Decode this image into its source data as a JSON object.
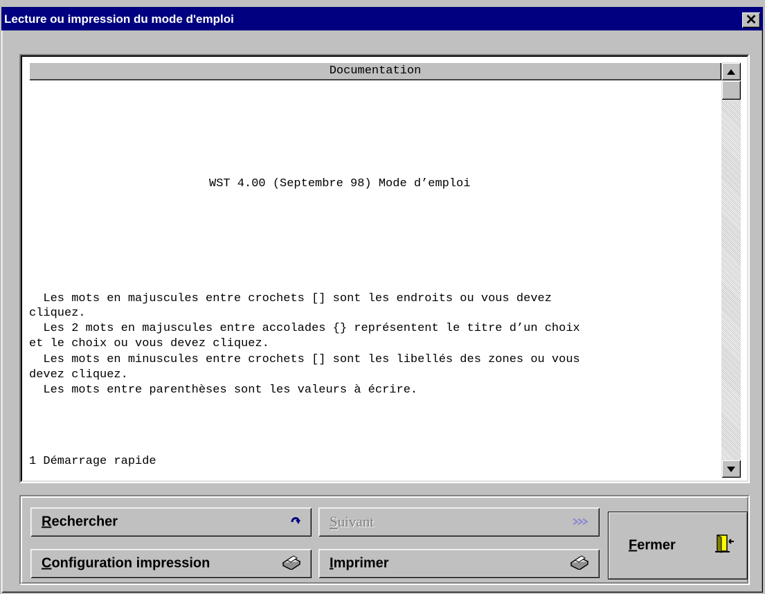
{
  "window": {
    "title": "Lecture ou impression du mode d'emploi",
    "close_glyph": "✕"
  },
  "document": {
    "column_header": "Documentation",
    "lines": [
      "WST 4.00 (Septembre 98) Mode d’emploi",
      "  Les mots en majuscules entre crochets [] sont les endroits ou vous devez",
      "cliquez.",
      "  Les 2 mots en majuscules entre accolades {} représentent le titre d’un choix",
      "et le choix ou vous devez cliquez.",
      "  Les mots en minuscules entre crochets [] sont les libellés des zones ou vous",
      "devez cliquez.",
      "  Les mots entre parenthèses sont les valeurs à écrire.",
      "1 Démarrage rapide"
    ]
  },
  "buttons": {
    "search": {
      "accel": "R",
      "rest": "echercher",
      "icon": "search-arrow-icon"
    },
    "next": {
      "accel": "S",
      "rest": "uivant",
      "icon": "double-chevron-icon",
      "disabled": true
    },
    "print_setup": {
      "accel": "C",
      "rest": "onfiguration impression",
      "icon": "printer-icon"
    },
    "print": {
      "accel": "I",
      "rest": "mprimer",
      "icon": "printer-icon"
    },
    "close": {
      "accel": "F",
      "rest": "ermer",
      "icon": "exit-door-icon"
    }
  },
  "colors": {
    "titlebar": "#000080",
    "face": "#c0c0c0",
    "disabled_text": "#808080"
  }
}
